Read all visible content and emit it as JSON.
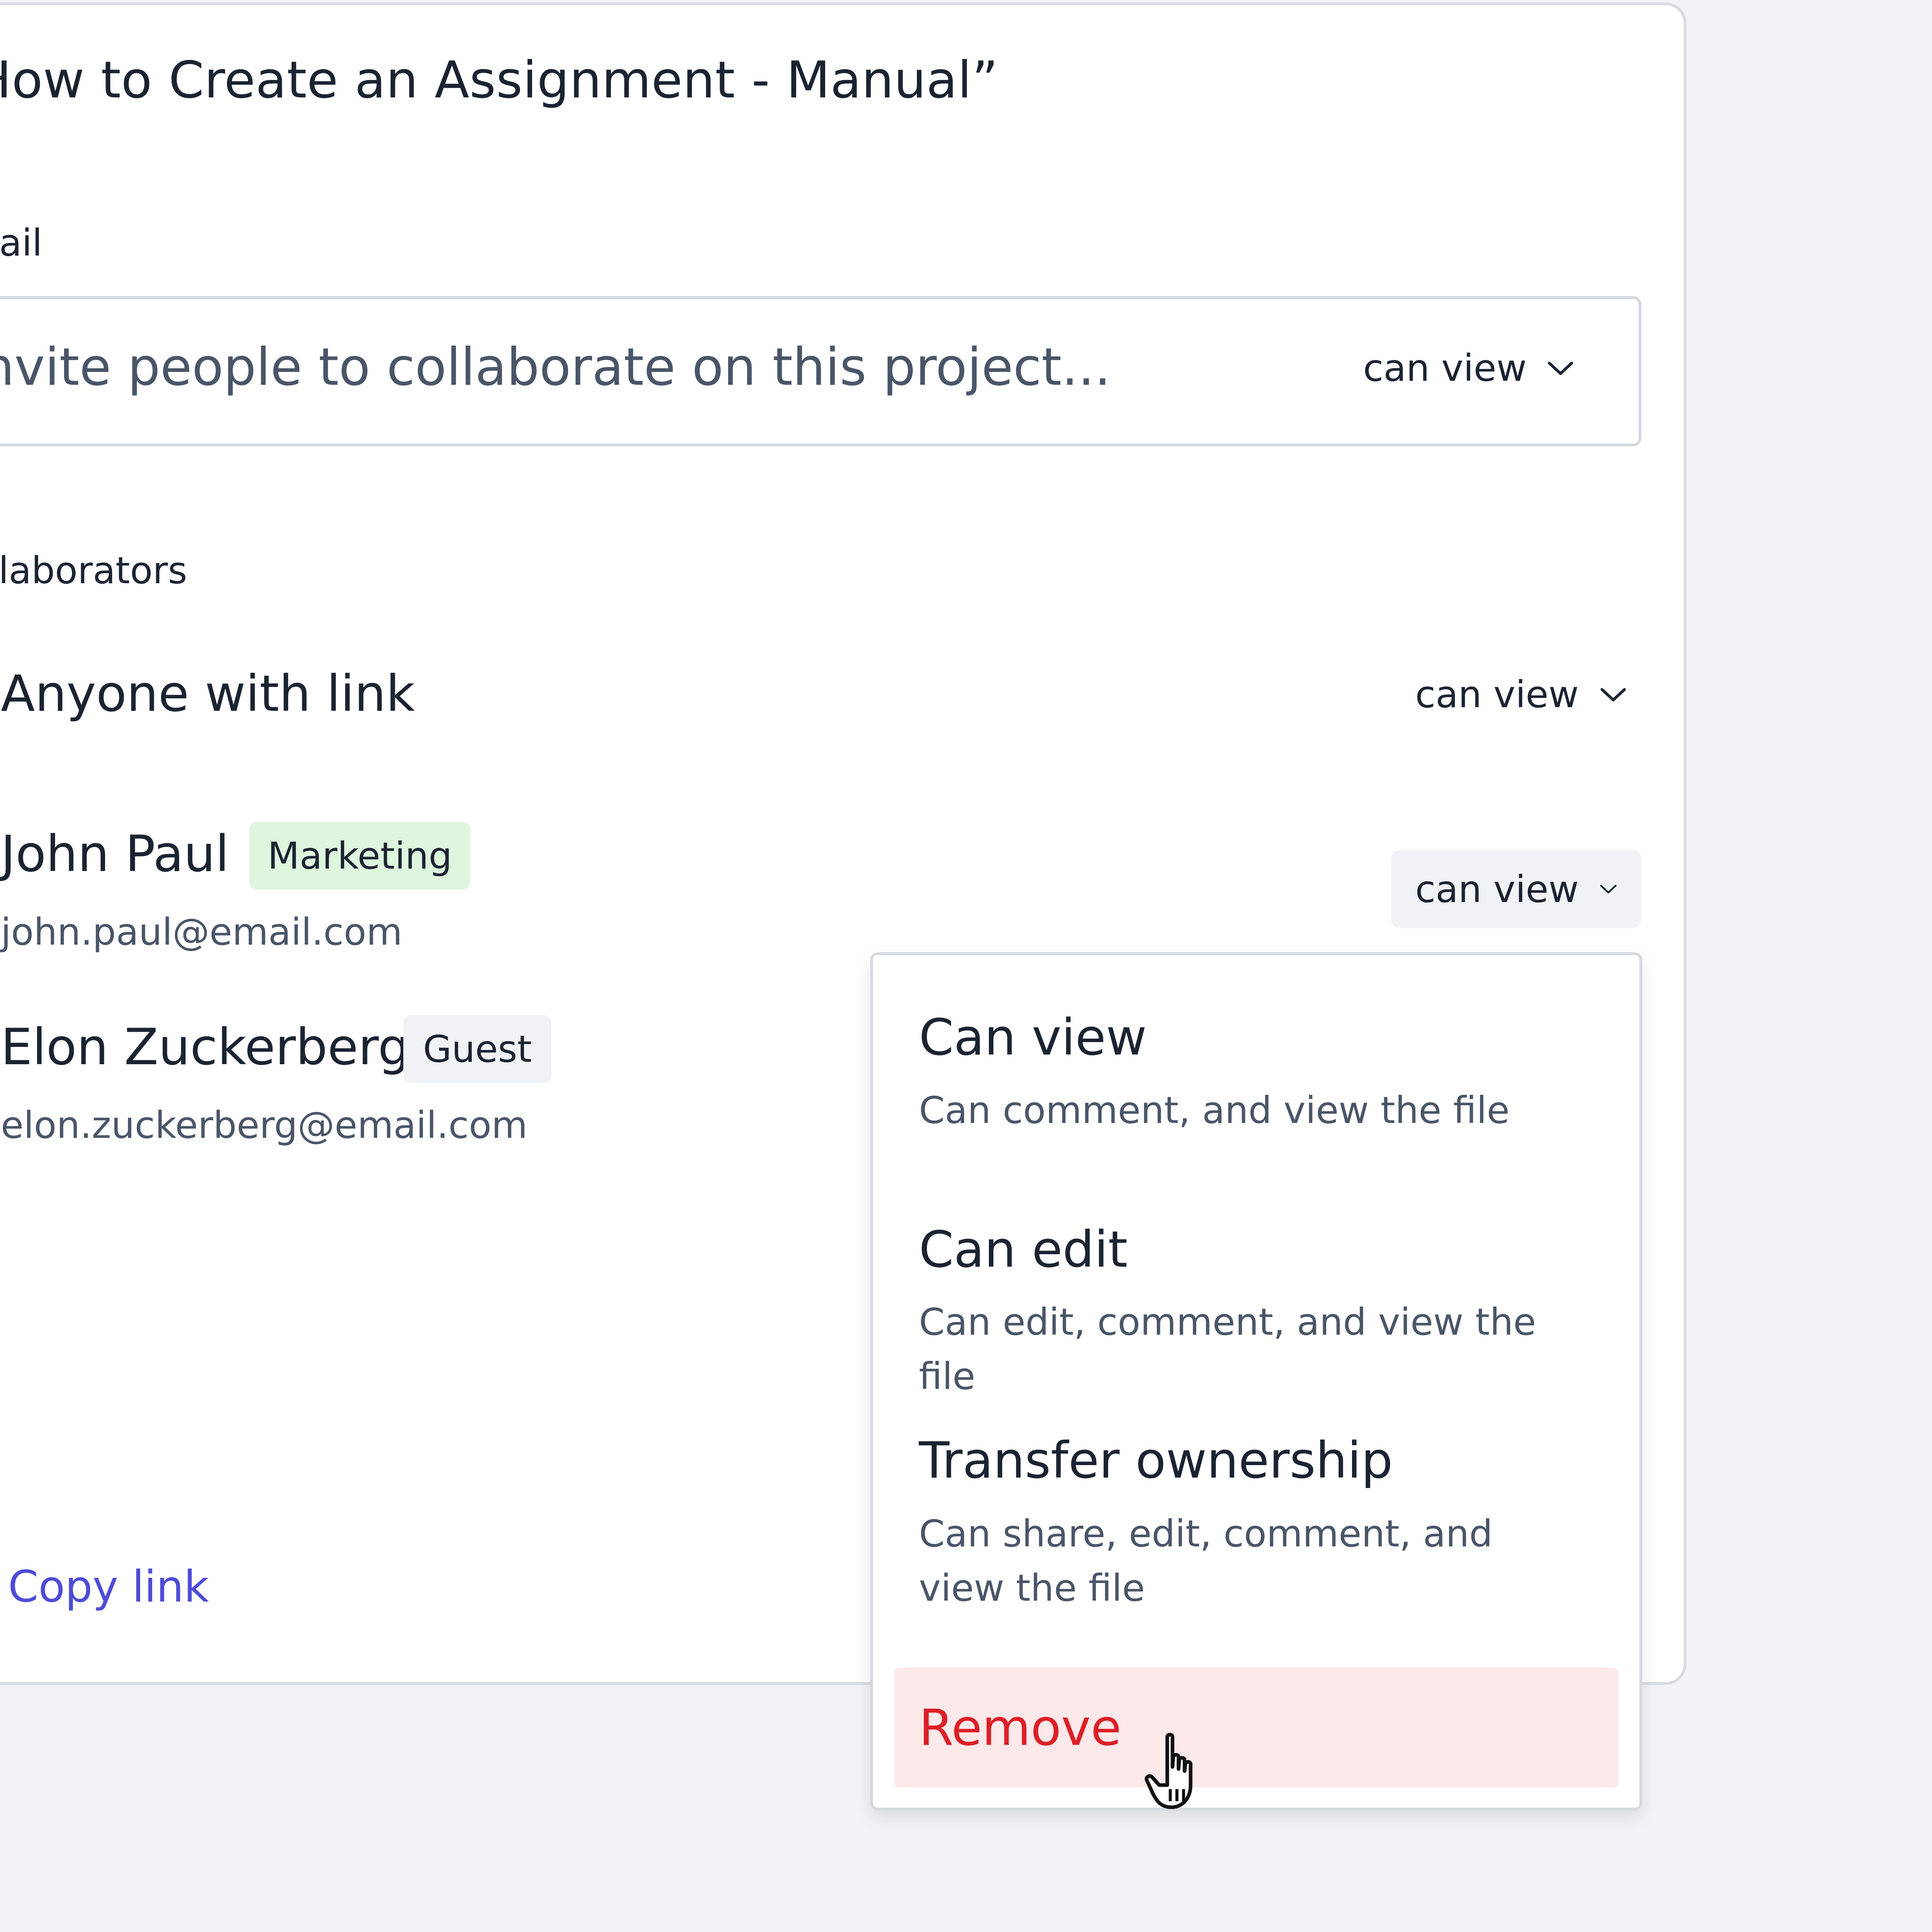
{
  "dialog": {
    "title": "“How to Create an Assignment - Manual”",
    "email_label": "Email",
    "email_placeholder": "Invite people to collaborate on this project...",
    "email_permission": "can view",
    "collaborators_label": "Collaborators",
    "copy_link_label": "Copy link"
  },
  "collaborators": [
    {
      "name": "Anyone with link",
      "permission": "can view"
    },
    {
      "name": "John Paul",
      "badge": "Marketing",
      "email": "john.paul@email.com",
      "permission": "can view"
    },
    {
      "name": "Elon Zuckerberg",
      "badge": "Guest",
      "email": "elon.zuckerberg@email.com"
    }
  ],
  "permission_menu": {
    "items": [
      {
        "title": "Can view",
        "description": "Can comment, and view the file"
      },
      {
        "title": "Can edit",
        "description": "Can edit, comment, and view the file"
      },
      {
        "title": "Transfer ownership",
        "description": "Can share, edit, comment, and view the file"
      }
    ],
    "remove_label": "Remove"
  },
  "colors": {
    "accent_link": "#4d4cd6",
    "danger": "#dc1f26",
    "danger_bg": "#fde8ea",
    "marketing_badge_bg": "#def5de",
    "guest_badge_bg": "#f0f2f5"
  },
  "icons": {
    "chevron": "chevron-down-icon",
    "cursor": "hand-pointer-cursor-icon"
  }
}
